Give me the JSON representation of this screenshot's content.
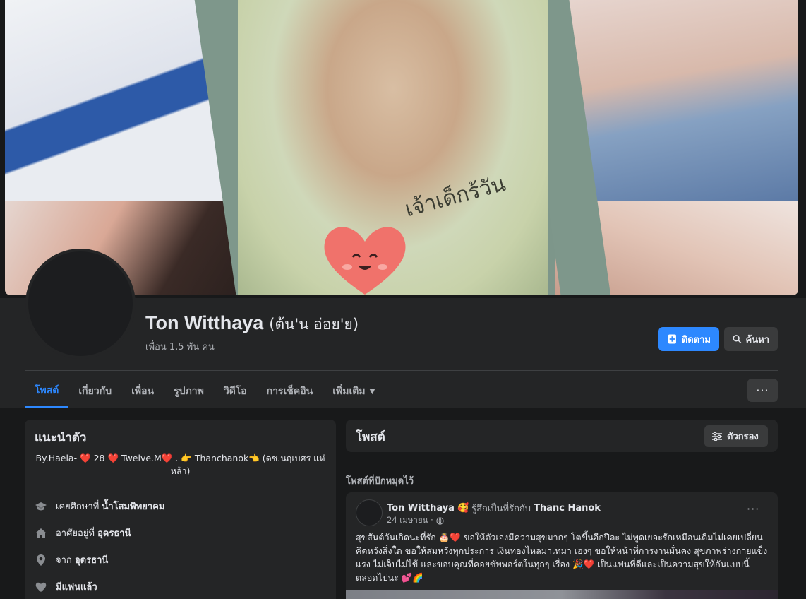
{
  "profile": {
    "name": "Ton Witthaya",
    "alt_name": "(ต้น'น อ่อย'ย)",
    "friends_count": "เพื่อน 1.5 พัน คน",
    "cover_caption": "เจ้าเด็กร้วัน"
  },
  "actions": {
    "follow_label": "ติดตาม",
    "search_label": "ค้นหา",
    "more_label": "···"
  },
  "tabs": [
    {
      "label": "โพสต์"
    },
    {
      "label": "เกี่ยวกับ"
    },
    {
      "label": "เพื่อน"
    },
    {
      "label": "รูปภาพ"
    },
    {
      "label": "วิดีโอ"
    },
    {
      "label": "การเช็คอิน"
    },
    {
      "label": "เพิ่มเติม"
    }
  ],
  "intro": {
    "title": "แนะนำตัว",
    "bio": "By.Haela- ❤️ 28 ❤️ Twelve.M❤️ . 👉 Thanchanok👈 (ดช.นฤเบศร แห่หล้า)",
    "items": [
      {
        "icon": "graduation-cap-icon",
        "prefix": "เคยศึกษาที่ ",
        "value": "น้ำโสมพิทยาคม"
      },
      {
        "icon": "home-icon",
        "prefix": "อาศัยอยู่ที่ ",
        "value": "อุดรธานี"
      },
      {
        "icon": "location-pin-icon",
        "prefix": "จาก ",
        "value": "อุดรธานี"
      },
      {
        "icon": "heart-icon",
        "prefix": "",
        "value": "มีแฟนแล้ว"
      }
    ]
  },
  "posts": {
    "title": "โพสต์",
    "filter_label": "ตัวกรอง",
    "pinned_label": "โพสต์ที่ปักหมุดไว้",
    "pinned": {
      "author": "Ton Witthaya",
      "feeling_emoji": "🥰",
      "feeling_text": "รู้สึกเป็นที่รักกับ",
      "tagged": "Thanc Hanok",
      "date": "24 เมษายน ·",
      "privacy_icon": "globe-icon",
      "text": "สุขสันต์วันเกิดนะที่รัก 🎂❤️ ขอให้ตัวเองมีความสุขมากๆ โตขึ้นอีกปีละ ไม่พูดเยอะรักเหมือนเดิมไม่เคยเปลี่ยน คิดหวังสิ่งใด ขอให้สมหวังทุกประการ เงินทองไหลมาเทมา เฮงๆ ขอให้หน้าที่การงานมั่นคง สุขภาพร่างกายแข็งแรง ไม่เจ็บไม่ไข้ และขอบคุณที่คอยซัพพอร์ตในทุกๆ เรื่อง 🎉❤️ เป็นแฟนที่ดีและเป็นความสุขให้กันแบบนี้ตลอดไปนะ 💕🌈"
    }
  },
  "colors": {
    "accent": "#2d88ff",
    "background": "#18191a",
    "card": "#242526",
    "button": "#3a3b3c"
  }
}
